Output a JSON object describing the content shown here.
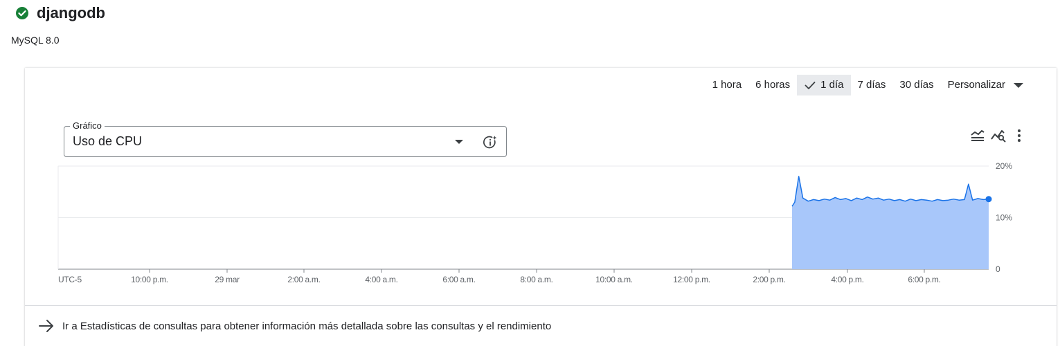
{
  "instance": {
    "name": "djangodb",
    "version": "MySQL 8.0",
    "status_color": "#188038"
  },
  "time_ranges": {
    "items": [
      {
        "label": "1 hora",
        "active": false
      },
      {
        "label": "6 horas",
        "active": false
      },
      {
        "label": "1 día",
        "active": true
      },
      {
        "label": "7 días",
        "active": false
      },
      {
        "label": "30 días",
        "active": false
      }
    ],
    "custom_label": "Personalizar"
  },
  "metric_select": {
    "legend": "Gráfico",
    "value": "Uso de CPU"
  },
  "chart_icons": [
    "legend-toggle-icon",
    "explore-chart-icon",
    "more-vert-icon"
  ],
  "chart_data": {
    "type": "area",
    "ylim": [
      0,
      20
    ],
    "y_ticks": [
      "20%",
      "10%",
      "0"
    ],
    "x_ticks": [
      "UTC-5",
      "10:00 p.m.",
      "29 mar",
      "2:00 a.m.",
      "4:00 a.m.",
      "6:00 a.m.",
      "8:00 a.m.",
      "10:00 a.m.",
      "12:00 p.m.",
      "2:00 p.m.",
      "4:00 p.m.",
      "6:00 p.m."
    ],
    "grid": true,
    "series": [
      {
        "color": "#1a73e8",
        "fill": "#a8c7fa",
        "x_hours": [
          14.6,
          14.7,
          14.85,
          15.0,
          15.2,
          15.4,
          15.6,
          15.8,
          16.0,
          16.2,
          16.4,
          16.6,
          16.8,
          17.0,
          17.2,
          17.4,
          17.6,
          17.8,
          18.0,
          18.2,
          18.4,
          18.6,
          18.8,
          19.0,
          19.2,
          19.4,
          19.6,
          19.8,
          20.0,
          20.2,
          20.4,
          20.6,
          20.8,
          21.0,
          21.15,
          21.3,
          21.5,
          21.7,
          21.9
        ],
        "values": [
          12.2,
          13.0,
          18.0,
          13.8,
          13.2,
          13.5,
          13.3,
          13.6,
          13.4,
          13.9,
          13.5,
          13.7,
          13.3,
          13.8,
          13.5,
          14.0,
          13.6,
          13.8,
          13.4,
          13.6,
          13.3,
          13.5,
          13.2,
          13.6,
          13.3,
          13.5,
          13.4,
          13.2,
          13.5,
          13.3,
          13.4,
          13.6,
          13.4,
          13.5,
          16.5,
          13.4,
          13.7,
          13.5,
          13.6
        ]
      }
    ]
  },
  "footer": {
    "link_text": "Ir a Estadísticas de consultas para obtener información más detallada sobre las consultas y el rendimiento"
  }
}
